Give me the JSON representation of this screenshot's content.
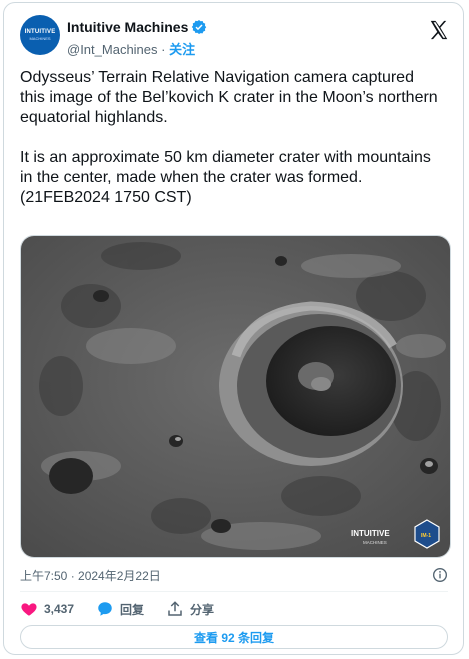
{
  "author": {
    "name": "Intuitive Machines",
    "handle": "@Int_Machines",
    "separator": "·",
    "follow_label": "关注",
    "avatar_text_line1": "INTUITIVE",
    "avatar_text_line2": "MACHINES"
  },
  "tweet": {
    "paragraph1": "Odysseus’ Terrain Relative Navigation camera captured this image of the Bel’kovich K crater in the Moon’s northern equatorial highlands.",
    "paragraph2_line1": "It is an approximate 50 km diameter crater with mountains in the center, made when the crater was formed.",
    "paragraph2_line2": "(21FEB2024 1750 CST)"
  },
  "media": {
    "watermark_line1": "INTUITIVE",
    "watermark_line2": "MACHINES",
    "mission_badge": "IM-1"
  },
  "meta": {
    "timestamp": "上午7:50 · 2024年2月22日"
  },
  "actions": {
    "likes": "3,437",
    "reply_label": "回复",
    "share_label": "分享"
  },
  "replies_button": "查看 92 条回复",
  "colors": {
    "accent": "#1d9bf0",
    "like": "#f91880",
    "muted": "#536471"
  },
  "icons": [
    "verified-badge-icon",
    "x-logo-icon",
    "info-icon",
    "heart-icon",
    "reply-bubble-icon",
    "share-icon"
  ]
}
